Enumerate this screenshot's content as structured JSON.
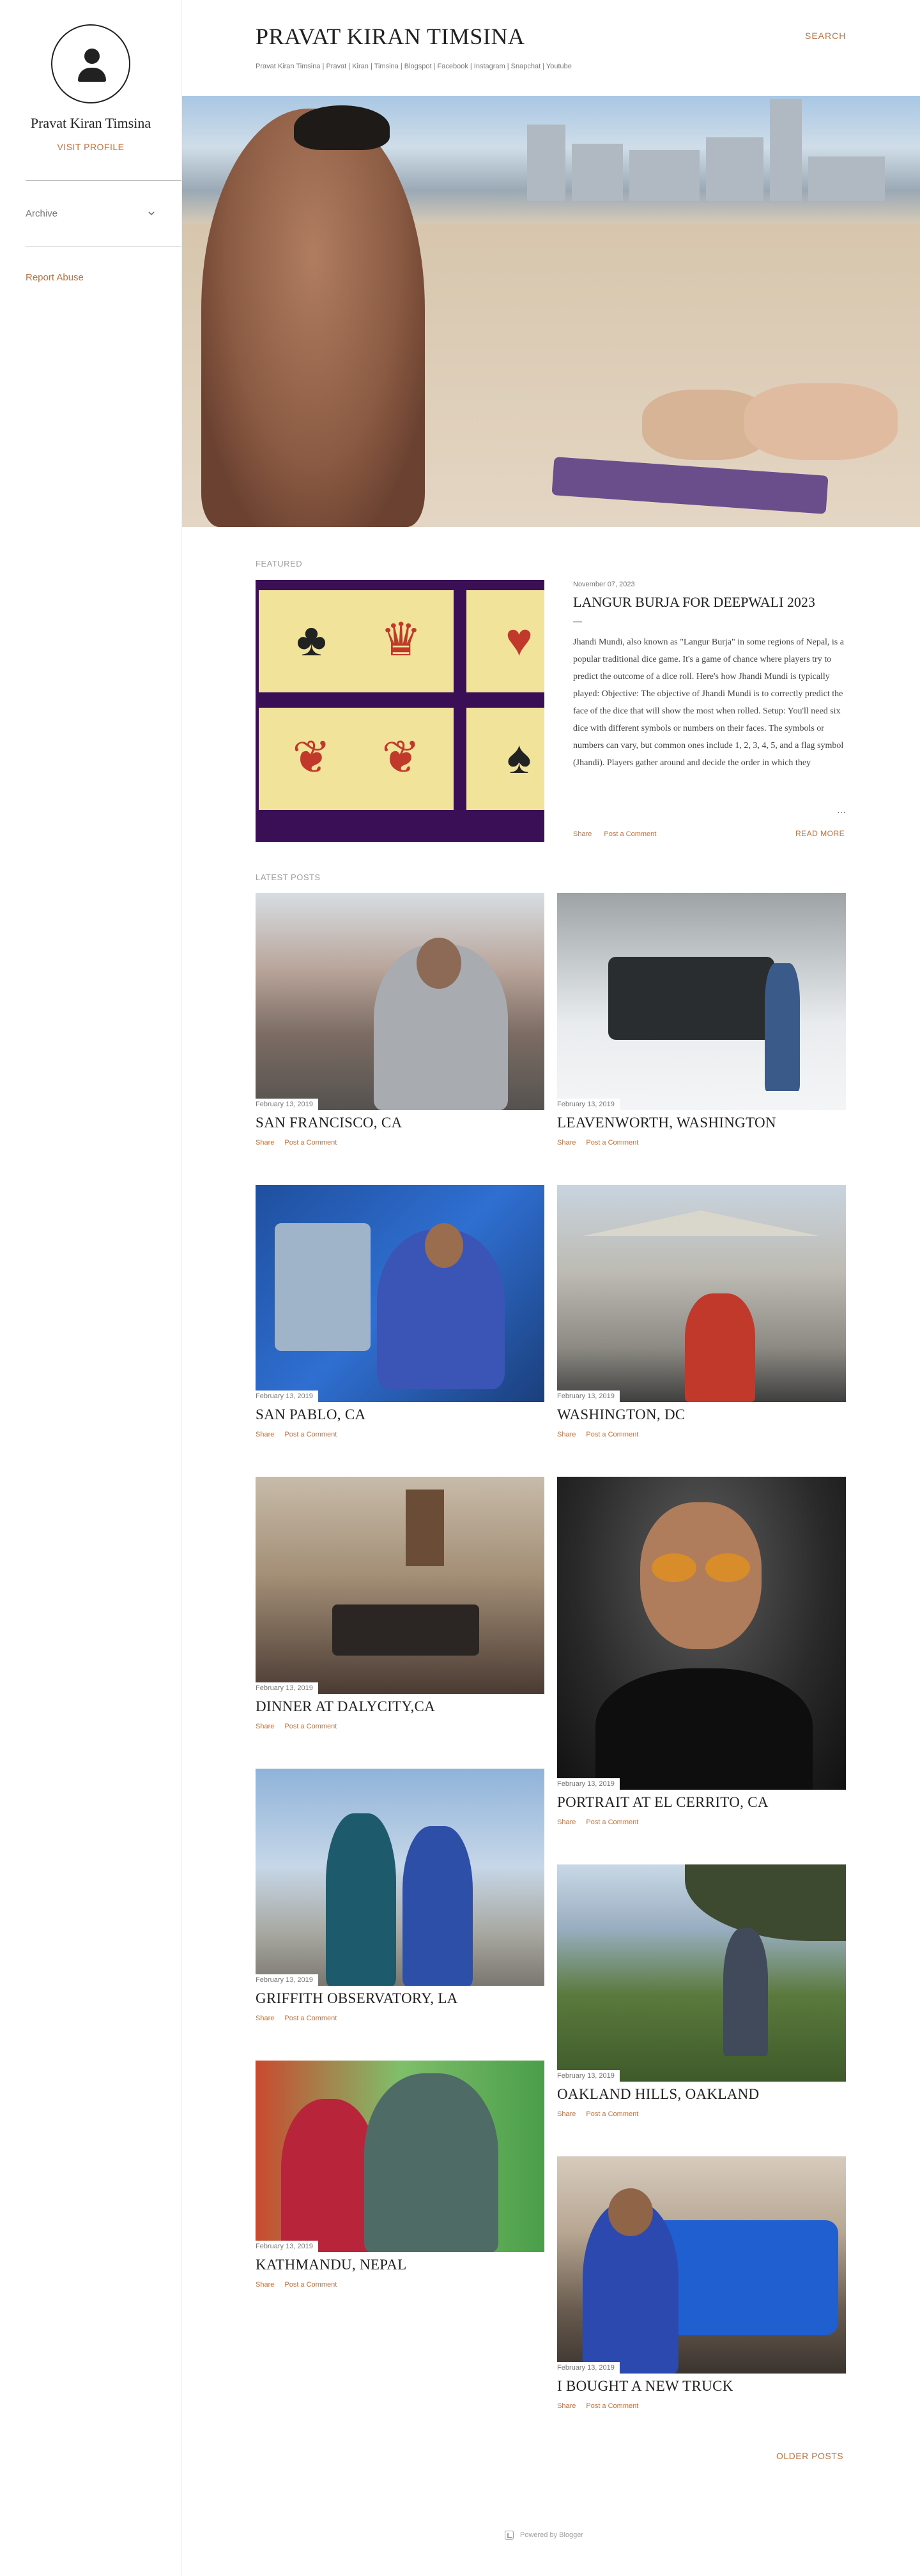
{
  "sidebar": {
    "profile_name": "Pravat Kiran Timsina",
    "visit_profile": "VISIT PROFILE",
    "archive": "Archive",
    "report_abuse": "Report Abuse"
  },
  "header": {
    "title": "PRAVAT KIRAN TIMSINA",
    "description": "Pravat Kiran Timsina | Pravat | Kiran | Timsina | Blogspot | Facebook | Instagram | Snapchat | Youtube",
    "search": "SEARCH"
  },
  "featured": {
    "label": "FEATURED",
    "date": "November 07, 2023",
    "title": "LANGUR BURJA FOR DEEPWALI 2023",
    "dash": "—",
    "snippet": "Jhandi Mundi, also known as \"Langur Burja\" in some regions of Nepal, is a popular traditional dice game. It's a game of chance where players try to predict the outcome of a dice roll. Here's how Jhandi Mundi is typically played: Objective: The objective of Jhandi Mundi is to correctly predict the face of the dice that will show the most when rolled. Setup: You'll need six dice with different symbols or numbers on their faces. The symbols or numbers can vary, but common ones include 1, 2, 3, 4, 5, and a flag symbol (Jhandi). Players gather around and decide the order in which they",
    "ellipsis": "…",
    "share": "Share",
    "comment": "Post a Comment",
    "read_more": "READ MORE",
    "card_symbols": [
      "♣",
      "♛",
      "♥",
      "❦",
      "❦",
      "♠"
    ]
  },
  "latest": {
    "label": "LATEST POSTS",
    "share": "Share",
    "comment": "Post a Comment",
    "posts": [
      {
        "date": "February 13, 2019",
        "title": "SAN FRANCISCO, CA"
      },
      {
        "date": "February 13, 2019",
        "title": "LEAVENWORTH, WASHINGTON"
      },
      {
        "date": "February 13, 2019",
        "title": "SAN PABLO, CA"
      },
      {
        "date": "February 13, 2019",
        "title": "WASHINGTON, DC"
      },
      {
        "date": "February 13, 2019",
        "title": "DINNER AT DALYCITY,CA"
      },
      {
        "date": "February 13, 2019",
        "title": "PORTRAIT AT EL CERRITO, CA"
      },
      {
        "date": "February 13, 2019",
        "title": "GRIFFITH OBSERVATORY, LA"
      },
      {
        "date": "February 13, 2019",
        "title": "OAKLAND HILLS, OAKLAND"
      },
      {
        "date": "February 13, 2019",
        "title": "KATHMANDU, NEPAL"
      },
      {
        "date": "February 13, 2019",
        "title": "I BOUGHT A NEW TRUCK"
      }
    ]
  },
  "older_posts": "OLDER POSTS",
  "footer": {
    "powered": "Powered by Blogger"
  },
  "colors": {
    "accent": "#c5703b",
    "text": "#212121",
    "muted": "#757575",
    "featured_bg": "#3b0f55",
    "card": "#f2e39a"
  }
}
